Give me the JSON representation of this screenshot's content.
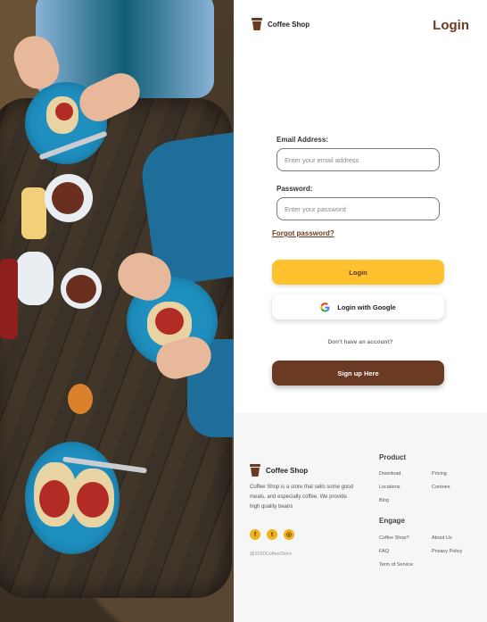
{
  "brand": {
    "name": "Coffee Shop"
  },
  "header": {
    "title": "Login"
  },
  "form": {
    "email_label": "Email Address:",
    "email_placeholder": "Enter your email address",
    "password_label": "Password:",
    "password_placeholder": "Enter your password",
    "forgot_link": "Forgot password?",
    "login_button": "Login",
    "google_button": "Login with Google",
    "no_account_text": "Don't have an account?",
    "signup_button": "Sign up Here"
  },
  "footer": {
    "brand_name": "Coffee Shop",
    "description": "Coffee Shop is a store that sells some good meals, and especially coffee. We provide high quality beans",
    "socials": [
      {
        "icon": "facebook-icon",
        "glyph": "f"
      },
      {
        "icon": "twitter-icon",
        "glyph": "t"
      },
      {
        "icon": "instagram-icon",
        "glyph": "◎"
      }
    ],
    "copyright": "@2020CoffeeStore",
    "product_heading": "Product",
    "product_links": [
      "Download",
      "Pricing",
      "Locations",
      "Contries",
      "Blog"
    ],
    "engage_heading": "Engage",
    "engage_links": [
      "Coffee Shop?",
      "About Us",
      "FAQ",
      "Privacy Policy",
      "Term of Service"
    ]
  },
  "colors": {
    "brand_brown": "#6b3a22",
    "accent_yellow": "#ffc12e",
    "footer_bg": "#f6f6f6"
  }
}
